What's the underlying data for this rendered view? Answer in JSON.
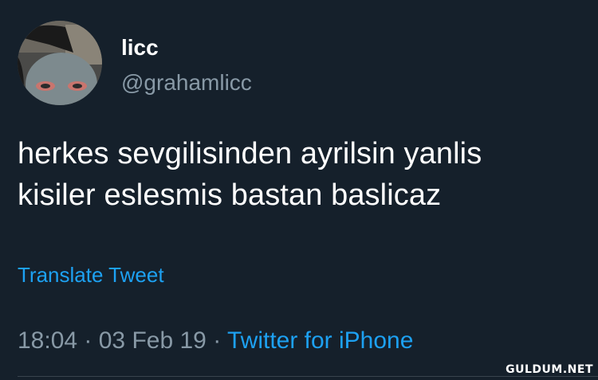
{
  "user": {
    "display_name": "licc",
    "handle": "@grahamlicc",
    "avatar_icon": "profile-photo"
  },
  "tweet": {
    "text_line1": "herkes sevgilisinden ayrilsin yanlis",
    "text_line2": "kisiler eslesmis bastan baslicaz",
    "translate_label": "Translate Tweet",
    "time": "18:04",
    "separator": " · ",
    "date": "03 Feb 19",
    "source": "Twitter for iPhone"
  },
  "watermark": "GULDUM.NET",
  "colors": {
    "background": "#15202b",
    "primary_text": "#ffffff",
    "secondary_text": "#8899a6",
    "link": "#1da1f2"
  }
}
